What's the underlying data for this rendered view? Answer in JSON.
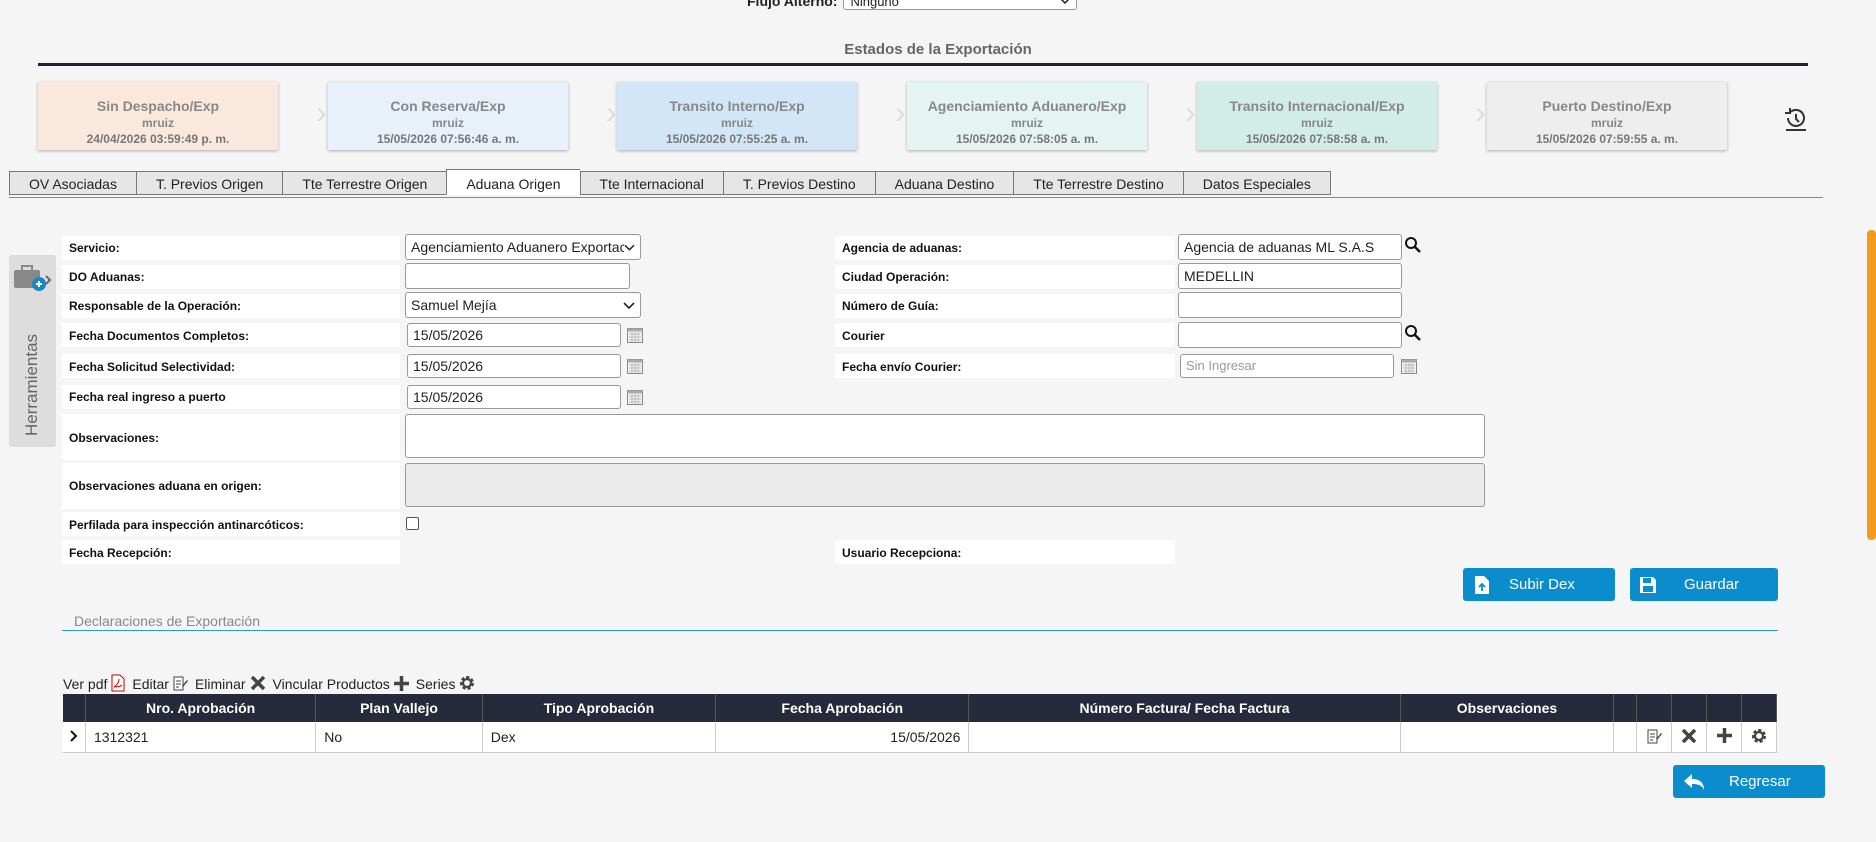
{
  "top": {
    "flow_label": "Flujo Alterno:",
    "flow_value": "Ninguno"
  },
  "states": {
    "title": "Estados de la Exportación",
    "cards": [
      {
        "title": "Sin Despacho/Exp",
        "user": "mruiz",
        "date": "24/04/2026 03:59:49 p. m.",
        "color": "#fbe8dd"
      },
      {
        "title": "Con Reserva/Exp",
        "user": "mruiz",
        "date": "15/05/2026 07:56:46 a. m.",
        "color": "#e8f1fa"
      },
      {
        "title": "Transito Interno/Exp",
        "user": "mruiz",
        "date": "15/05/2026 07:55:25 a. m.",
        "color": "#d3e6f7"
      },
      {
        "title": "Agenciamiento Aduanero/Exp",
        "user": "mruiz",
        "date": "15/05/2026 07:58:05 a. m.",
        "color": "#e4f5f1"
      },
      {
        "title": "Transito Internacional/Exp",
        "user": "mruiz",
        "date": "15/05/2026 07:58:58 a. m.",
        "color": "#d2ede6"
      },
      {
        "title": "Puerto Destino/Exp",
        "user": "mruiz",
        "date": "15/05/2026 07:59:55 a. m.",
        "color": "#eeeeee"
      }
    ]
  },
  "tabs": [
    {
      "label": "OV Asociadas"
    },
    {
      "label": "T. Previos Origen"
    },
    {
      "label": "Tte Terrestre Origen"
    },
    {
      "label": "Aduana Origen",
      "active": true
    },
    {
      "label": "Tte Internacional"
    },
    {
      "label": "T. Previos Destino"
    },
    {
      "label": "Aduana Destino"
    },
    {
      "label": "Tte Terrestre Destino"
    },
    {
      "label": "Datos Especiales"
    }
  ],
  "tools": {
    "label": "Herramientas"
  },
  "form": {
    "servicio_label": "Servicio:",
    "servicio_value": "Agenciamiento Aduanero Exportación",
    "do_label": "DO Aduanas:",
    "do_value": "",
    "responsable_label": "Responsable de la Operación:",
    "responsable_value": "Samuel Mejía",
    "fdc_label": "Fecha Documentos Completos:",
    "fdc_value": "15/05/2026",
    "fss_label": "Fecha Solicitud Selectividad:",
    "fss_value": "15/05/2026",
    "fri_label": "Fecha real ingreso a puerto",
    "fri_value": "15/05/2026",
    "agencia_label": "Agencia de aduanas:",
    "agencia_value": "Agencia de aduanas ML S.A.S",
    "ciudad_label": "Ciudad Operación:",
    "ciudad_value": "MEDELLIN",
    "guia_label": "Número de Guía:",
    "guia_value": "",
    "courier_label": "Courier",
    "courier_value": "",
    "fec_label": "Fecha envío Courier:",
    "fec_placeholder": "Sin Ingresar",
    "obs_label": "Observaciones:",
    "obs_value": "",
    "obs_origen_label": "Observaciones aduana en origen:",
    "obs_origen_value": "",
    "perfilada_label": "Perfilada para inspección antinarcóticos:",
    "recepcion_label": "Fecha Recepción:",
    "usuario_label": "Usuario Recepciona:"
  },
  "buttons": {
    "subir_dex": "Subir Dex",
    "guardar": "Guardar",
    "regresar": "Regresar"
  },
  "declaraciones": {
    "title": "Declaraciones de Exportación",
    "toolbar": {
      "ver_pdf": "Ver pdf",
      "editar": "Editar",
      "eliminar": "Eliminar",
      "vincular": "Vincular Productos",
      "series": "Series"
    },
    "columns": [
      "Nro. Aprobación",
      "Plan Vallejo",
      "Tipo Aprobación",
      "Fecha Aprobación",
      "Número Factura/ Fecha Factura",
      "Observaciones"
    ],
    "rows": [
      {
        "nro": "1312321",
        "plan": "No",
        "tipo": "Dex",
        "fecha": "15/05/2026",
        "factura": "",
        "obs": ""
      }
    ]
  }
}
